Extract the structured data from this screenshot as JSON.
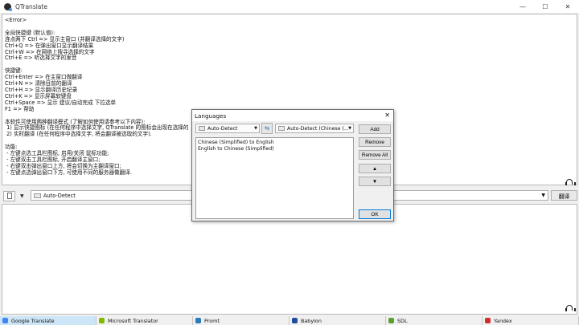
{
  "window": {
    "title": "QTranslate",
    "minimize": "—",
    "maximize": "☐",
    "close": "✕"
  },
  "upper_text": "<Error>\n\n全局快捷键 (默认值):\n连点两下 Ctrl => 显示主窗口 (并翻译选择的文字)\nCtrl+Q => 在弹出窗口显示翻译结果\nCtrl+W => 在网络上搜寻选择的文字\nCtrl+E => 听选择文字的发音\n\n快捷键:\nCtrl+Enter => 在主窗口做翻译\nCtrl+N => 清除目前的翻译\nCtrl+H => 显示翻译历史纪录\nCtrl+K => 显示屏幕软键盘\nCtrl+Space => 显示 建议/自动完成 下拉选单\nF1 => 帮助\n\n本软件可使用两种翻译模式 (了解如何使用请参考以下内容):\n 1) 显示快捷图标 (在任何程序中选择文字, QTranslate 的图标会出现在选择的\n 2) 实时翻译 (在任何程序中选择文字, 将会翻译被选取的文字).\n\n功能:\n - 左键点选工具栏图标, 启用/关闭 鼠标功能;\n - 左键双击工具栏图标, 开启翻译主窗口;\n - 右键双击弹出窗口上方, 将会切换为主翻译窗口;\n - 左键点选弹出窗口下方, 可使用不同的服务器做翻译.",
  "toolbar": {
    "language": "Auto-Detect",
    "translate_label": "翻译"
  },
  "tabs": [
    {
      "label": "Google Translate",
      "color": "#4285f4",
      "active": true
    },
    {
      "label": "Microsoft Translator",
      "color": "#7fba00",
      "active": false
    },
    {
      "label": "Promt",
      "color": "#2b7bb9",
      "active": false
    },
    {
      "label": "Babylon",
      "color": "#1f4e9c",
      "active": false
    },
    {
      "label": "SDL",
      "color": "#5aa02c",
      "active": false
    },
    {
      "label": "Yandex",
      "color": "#d22d2d",
      "active": false
    }
  ],
  "dialog": {
    "title": "Languages",
    "close": "✕",
    "source_language": "Auto-Detect",
    "target_language": "Auto-Detect (Chinese (...",
    "pairs": [
      "Chinese (Simplified) to English",
      "English to Chinese (Simplified)"
    ],
    "buttons": {
      "add": "Add",
      "remove": "Remove",
      "remove_all": "Remove All",
      "up": "▲",
      "down": "▼",
      "ok": "OK"
    }
  }
}
